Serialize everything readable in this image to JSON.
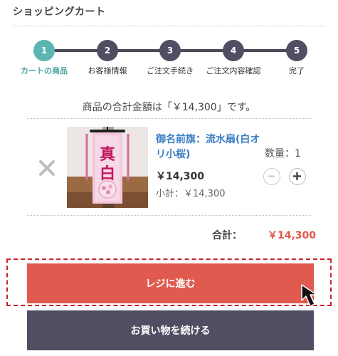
{
  "page_title": "ショッピングカート",
  "steps": [
    {
      "number": "1",
      "label": "カートの商品",
      "active": true
    },
    {
      "number": "2",
      "label": "お客様情報",
      "active": false
    },
    {
      "number": "3",
      "label": "ご注文手続き",
      "active": false
    },
    {
      "number": "4",
      "label": "ご注文内容確認",
      "active": false
    },
    {
      "number": "5",
      "label": "完了",
      "active": false
    }
  ],
  "summary_text": "商品の合計金額は「￥14,300」です。",
  "cart_item": {
    "name": "御名前旗：流水扇(白オリ小桜)",
    "price": "￥14,300",
    "subtotal": "小計：￥14,300",
    "quantity_label": "数量：1",
    "image_text": "真白"
  },
  "total": {
    "label": "合計：",
    "value": "￥14,300"
  },
  "buttons": {
    "checkout": "レジに進む",
    "continue": "お買い物を続ける"
  },
  "colors": {
    "accent_teal": "#5bb5b0",
    "step_dark": "#4f4e63",
    "price_red": "#e0584d",
    "checkout_button": "#e05a50",
    "continue_button": "#4f4e63",
    "product_link": "#3a7cc4",
    "highlight_dash": "#cc1e2a"
  },
  "icons": {
    "remove": "close-icon",
    "decrease": "minus-icon",
    "increase": "plus-icon",
    "pointer": "mouse-cursor-icon"
  }
}
